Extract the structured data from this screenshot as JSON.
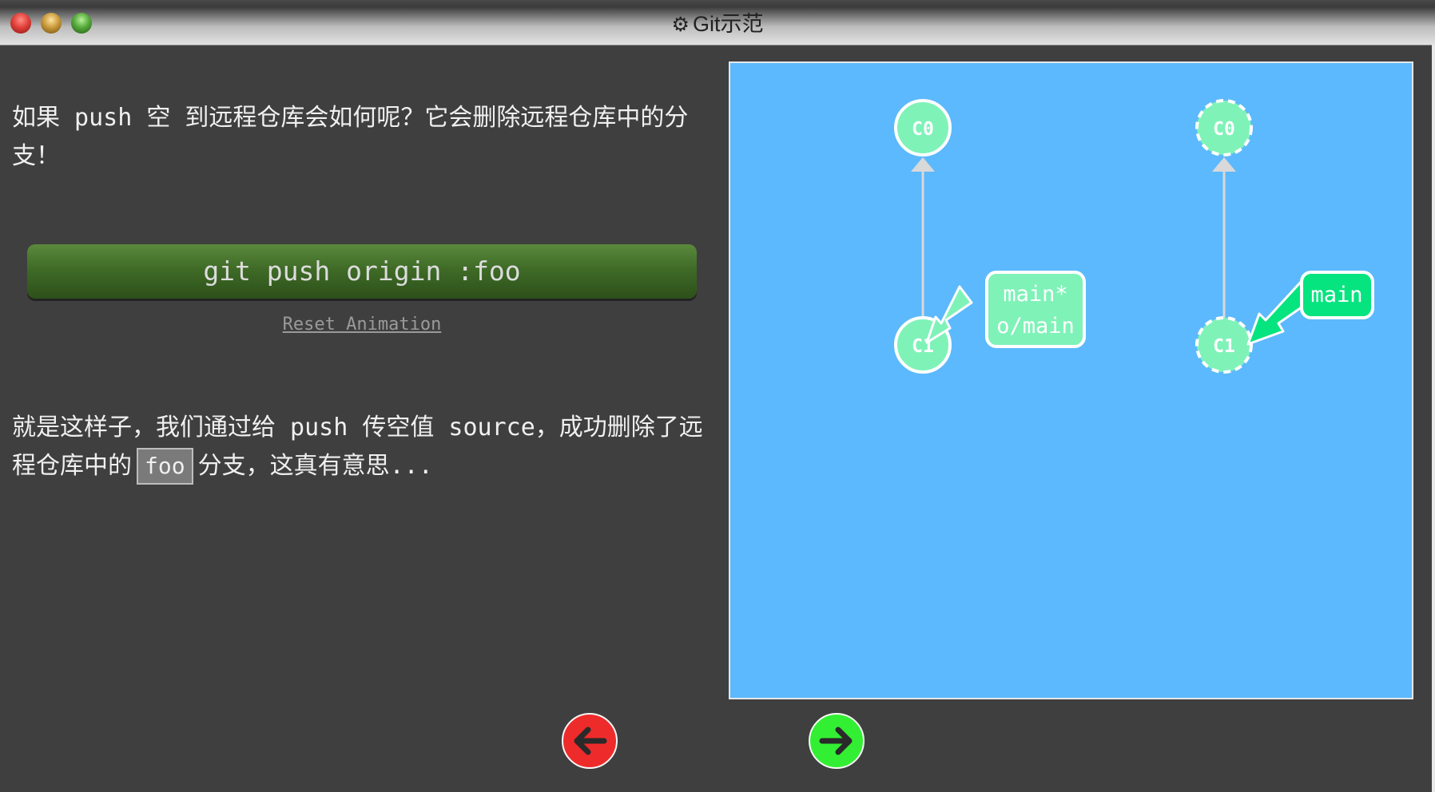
{
  "window": {
    "title": "Git示范",
    "gear_icon": "gear-icon"
  },
  "lesson": {
    "para1": "如果 push 空 到远程仓库会如何呢？它会删除远程仓库中的分支！",
    "command": "git push origin :foo",
    "reset_label": "Reset Animation",
    "para2_before": "就是这样子，我们通过给 push 传空值 source，成功删除了远程仓库中的",
    "para2_code": "foo",
    "para2_after": "分支，这真有意思..."
  },
  "graph": {
    "local": {
      "commits": [
        "C0",
        "C1"
      ],
      "branch_labels": [
        "main*",
        "o/main"
      ]
    },
    "remote": {
      "commits": [
        "C0",
        "C1"
      ],
      "branch_labels": [
        "main"
      ]
    },
    "colors": {
      "background": "#5cb9fd",
      "commit_fill": "#7ff2b8",
      "branch_local": "#7ff2b8",
      "branch_remote": "#06e47f"
    }
  },
  "nav": {
    "back_icon": "arrow-left-icon",
    "forward_icon": "arrow-right-icon",
    "back_color": "#ee2b2b",
    "forward_color": "#33ef33"
  }
}
